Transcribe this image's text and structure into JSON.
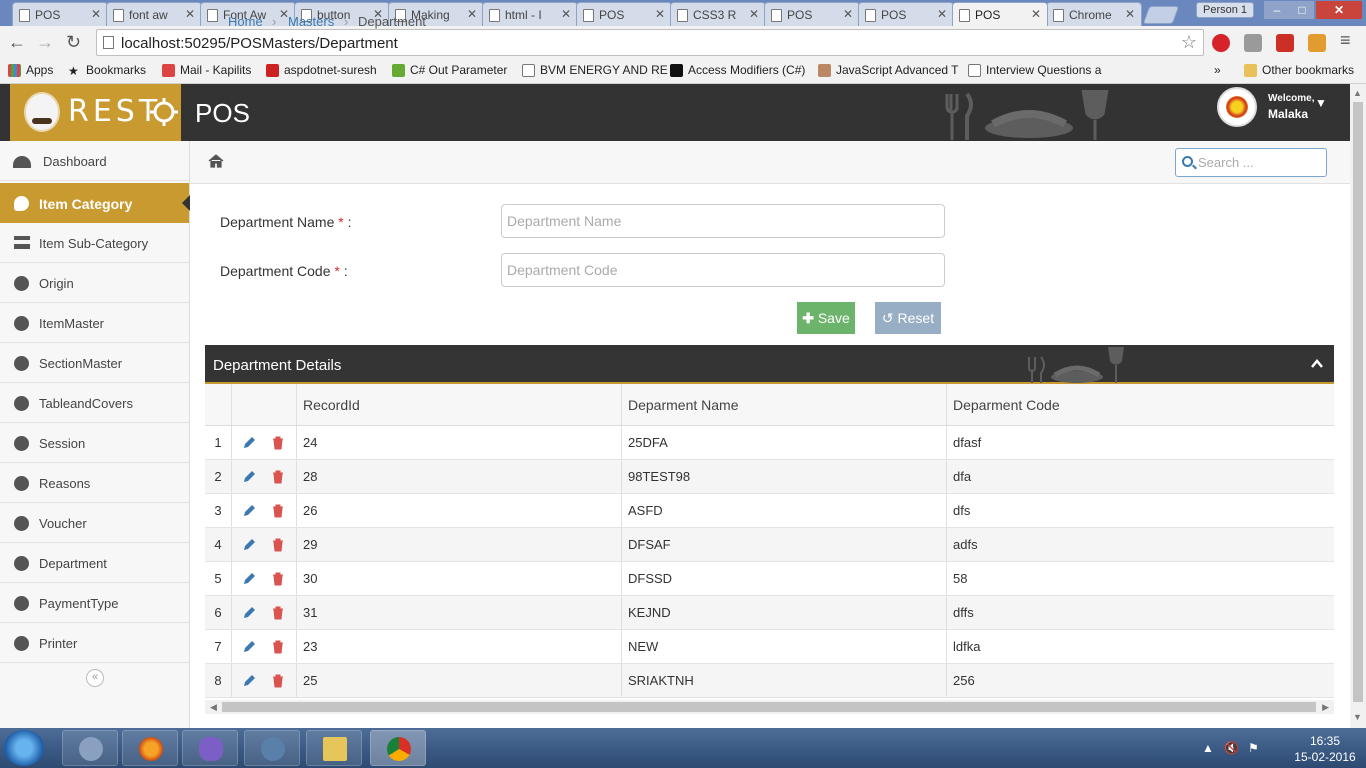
{
  "browser": {
    "tabs": [
      {
        "label": "POS"
      },
      {
        "label": "font aw"
      },
      {
        "label": "Font Aw"
      },
      {
        "label": "button"
      },
      {
        "label": "Making"
      },
      {
        "label": "html - I"
      },
      {
        "label": "POS"
      },
      {
        "label": "CSS3 R"
      },
      {
        "label": "POS"
      },
      {
        "label": "POS"
      },
      {
        "label": "POS"
      },
      {
        "label": "Chrome"
      }
    ],
    "profile": "Person 1",
    "url": "localhost:50295/POSMasters/Department",
    "bookmarks": [
      {
        "label": "Apps"
      },
      {
        "label": "Bookmarks"
      },
      {
        "label": "Mail - Kapilits"
      },
      {
        "label": "aspdotnet-suresh"
      },
      {
        "label": "C# Out Parameter"
      },
      {
        "label": "BVM ENERGY AND RE"
      },
      {
        "label": "Access Modifiers (C#)"
      },
      {
        "label": "JavaScript Advanced T"
      },
      {
        "label": "Interview Questions a"
      },
      {
        "label": "Other bookmarks"
      }
    ]
  },
  "header": {
    "brand": "REST",
    "title": "POS",
    "welcome": "Welcome,",
    "username": "Malaka"
  },
  "sidebar": {
    "items": [
      {
        "label": "Dashboard"
      },
      {
        "label": "Item Category"
      },
      {
        "label": "Item Sub-Category"
      },
      {
        "label": "Origin"
      },
      {
        "label": "ItemMaster"
      },
      {
        "label": "SectionMaster"
      },
      {
        "label": "TableandCovers"
      },
      {
        "label": "Session"
      },
      {
        "label": "Reasons"
      },
      {
        "label": "Voucher"
      },
      {
        "label": "Department"
      },
      {
        "label": "PaymentType"
      },
      {
        "label": "Printer"
      }
    ],
    "collapse_glyph": "«"
  },
  "breadcrumb": {
    "home": "Home",
    "masters": "Masters",
    "current": "Department"
  },
  "search": {
    "placeholder": "Search ..."
  },
  "form": {
    "name_label": "Department Name",
    "code_label": "Department Code",
    "required_mark": "*",
    "colon": " :",
    "name_placeholder": "Department Name",
    "code_placeholder": "Department Code",
    "save_label": "Save",
    "reset_label": "Reset"
  },
  "panel": {
    "title": "Department Details"
  },
  "table": {
    "headers": [
      "",
      "",
      "RecordId",
      "Deparment Name",
      "Deparment Code"
    ],
    "rows": [
      {
        "n": "1",
        "id": "24",
        "name": "25DFA",
        "code": "dfasf"
      },
      {
        "n": "2",
        "id": "28",
        "name": "98TEST98",
        "code": "dfa"
      },
      {
        "n": "3",
        "id": "26",
        "name": "ASFD",
        "code": "dfs"
      },
      {
        "n": "4",
        "id": "29",
        "name": "DFSAF",
        "code": "adfs"
      },
      {
        "n": "5",
        "id": "30",
        "name": "DFSSD",
        "code": "58"
      },
      {
        "n": "6",
        "id": "31",
        "name": "KEJND",
        "code": "dffs"
      },
      {
        "n": "7",
        "id": "23",
        "name": "NEW",
        "code": "ldfka"
      },
      {
        "n": "8",
        "id": "25",
        "name": "SRIAKTNH",
        "code": "256"
      }
    ]
  },
  "taskbar": {
    "time": "16:35",
    "date": "15-02-2016"
  },
  "colors": {
    "accent": "#c89a2f",
    "header": "#333333",
    "save": "#6cb46c",
    "reset": "#97aec4",
    "link": "#3a7ab0",
    "delete": "#d9534f"
  }
}
